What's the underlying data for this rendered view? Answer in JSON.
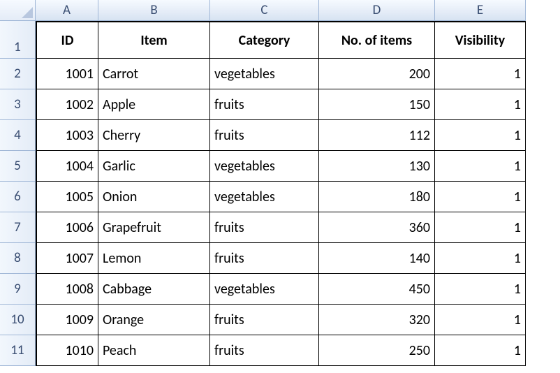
{
  "columns": [
    "A",
    "B",
    "C",
    "D",
    "E"
  ],
  "rowNumbers": [
    1,
    2,
    3,
    4,
    5,
    6,
    7,
    8,
    9,
    10,
    11
  ],
  "headers": {
    "id": "ID",
    "item": "Item",
    "category": "Category",
    "noOfItems": "No. of items",
    "visibility": "Visibility"
  },
  "rows": [
    {
      "id": 1001,
      "item": "Carrot",
      "category": "vegetables",
      "noOfItems": 200,
      "visibility": 1
    },
    {
      "id": 1002,
      "item": "Apple",
      "category": "fruits",
      "noOfItems": 150,
      "visibility": 1
    },
    {
      "id": 1003,
      "item": "Cherry",
      "category": "fruits",
      "noOfItems": 112,
      "visibility": 1
    },
    {
      "id": 1004,
      "item": "Garlic",
      "category": "vegetables",
      "noOfItems": 130,
      "visibility": 1
    },
    {
      "id": 1005,
      "item": "Onion",
      "category": "vegetables",
      "noOfItems": 180,
      "visibility": 1
    },
    {
      "id": 1006,
      "item": "Grapefruit",
      "category": "fruits",
      "noOfItems": 360,
      "visibility": 1
    },
    {
      "id": 1007,
      "item": "Lemon",
      "category": "fruits",
      "noOfItems": 140,
      "visibility": 1
    },
    {
      "id": 1008,
      "item": "Cabbage",
      "category": "vegetables",
      "noOfItems": 450,
      "visibility": 1
    },
    {
      "id": 1009,
      "item": "Orange",
      "category": "fruits",
      "noOfItems": 320,
      "visibility": 1
    },
    {
      "id": 1010,
      "item": "Peach",
      "category": "fruits",
      "noOfItems": 250,
      "visibility": 1
    }
  ]
}
